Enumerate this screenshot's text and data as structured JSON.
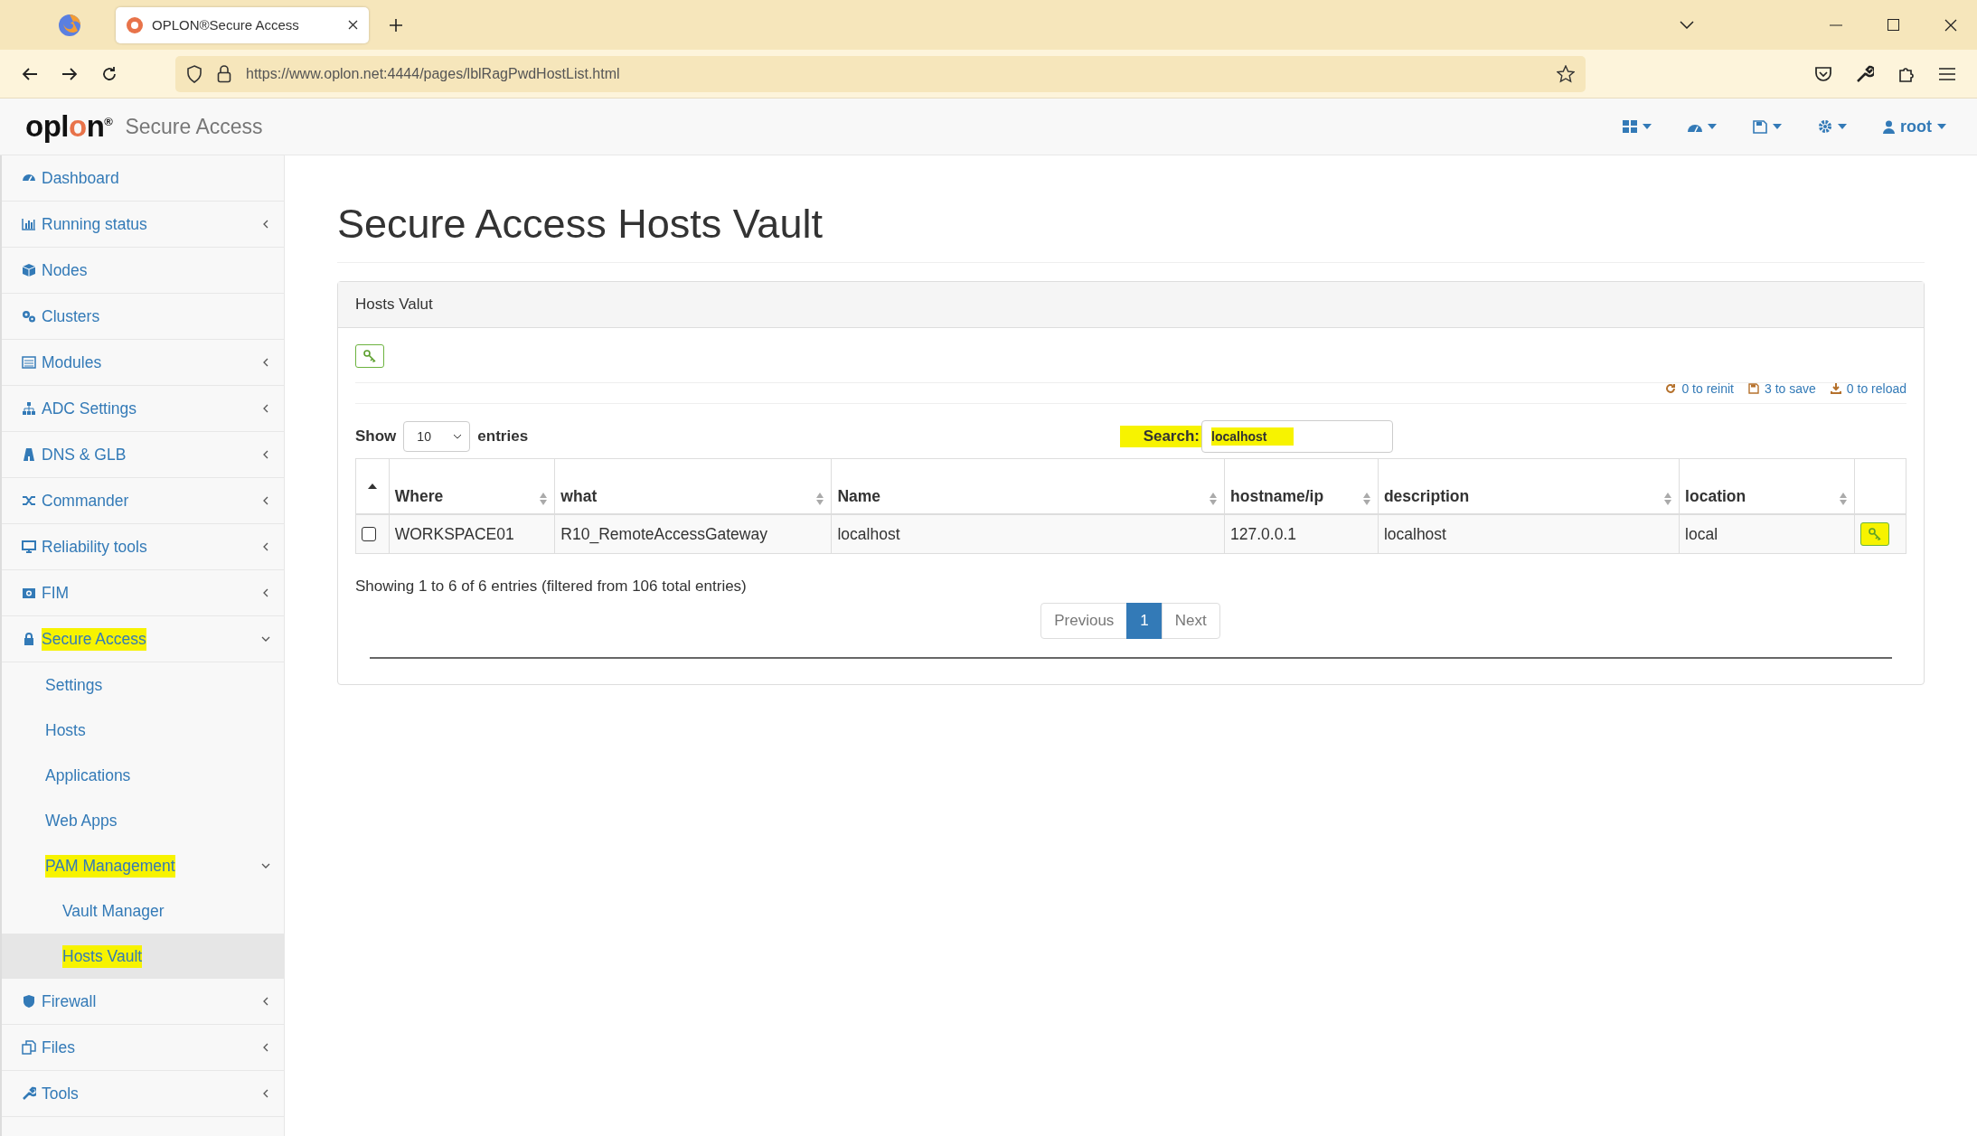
{
  "browser": {
    "tab_title": "OPLON®Secure Access",
    "url": "https://www.oplon.net:4444/pages/lblRagPwdHostList.html"
  },
  "header": {
    "logo": "oplon",
    "logo_mark": "®",
    "product": "Secure Access",
    "user": "root"
  },
  "sidebar": {
    "items": [
      {
        "label": "Dashboard",
        "has_children": false,
        "expanded": false,
        "selected": false,
        "highlighted": false
      },
      {
        "label": "Running status",
        "has_children": true,
        "expanded": false,
        "selected": false,
        "highlighted": false
      },
      {
        "label": "Nodes",
        "has_children": false,
        "expanded": false,
        "selected": false,
        "highlighted": false
      },
      {
        "label": "Clusters",
        "has_children": false,
        "expanded": false,
        "selected": false,
        "highlighted": false
      },
      {
        "label": "Modules",
        "has_children": true,
        "expanded": false,
        "selected": false,
        "highlighted": false
      },
      {
        "label": "ADC Settings",
        "has_children": true,
        "expanded": false,
        "selected": false,
        "highlighted": false
      },
      {
        "label": "DNS & GLB",
        "has_children": true,
        "expanded": false,
        "selected": false,
        "highlighted": false
      },
      {
        "label": "Commander",
        "has_children": true,
        "expanded": false,
        "selected": false,
        "highlighted": false
      },
      {
        "label": "Reliability tools",
        "has_children": true,
        "expanded": false,
        "selected": false,
        "highlighted": false
      },
      {
        "label": "FIM",
        "has_children": true,
        "expanded": false,
        "selected": false,
        "highlighted": false
      },
      {
        "label": "Secure Access",
        "has_children": true,
        "expanded": true,
        "selected": false,
        "highlighted": true,
        "children": [
          {
            "label": "Settings",
            "has_children": false,
            "expanded": false,
            "selected": false,
            "highlighted": false
          },
          {
            "label": "Hosts",
            "has_children": false,
            "expanded": false,
            "selected": false,
            "highlighted": false
          },
          {
            "label": "Applications",
            "has_children": false,
            "expanded": false,
            "selected": false,
            "highlighted": false
          },
          {
            "label": "Web Apps",
            "has_children": false,
            "expanded": false,
            "selected": false,
            "highlighted": false
          },
          {
            "label": "PAM Management",
            "has_children": true,
            "expanded": true,
            "selected": false,
            "highlighted": true,
            "children": [
              {
                "label": "Vault Manager",
                "has_children": false,
                "expanded": false,
                "selected": false,
                "highlighted": false
              },
              {
                "label": "Hosts Vault",
                "has_children": false,
                "expanded": false,
                "selected": true,
                "highlighted": true
              }
            ]
          }
        ]
      },
      {
        "label": "Firewall",
        "has_children": true,
        "expanded": false,
        "selected": false,
        "highlighted": false
      },
      {
        "label": "Files",
        "has_children": true,
        "expanded": false,
        "selected": false,
        "highlighted": false
      },
      {
        "label": "Tools",
        "has_children": true,
        "expanded": false,
        "selected": false,
        "highlighted": false
      }
    ]
  },
  "page_title": "Secure Access Hosts Vault",
  "panel": {
    "title": "Hosts Valut",
    "status_links": [
      "0 to reinit",
      "3 to save",
      "0 to reload"
    ],
    "length": {
      "label_before": "Show",
      "value": "10",
      "label_after": "entries"
    },
    "search": {
      "label": "Search:",
      "value": "localhost",
      "highlighted": true
    },
    "table": {
      "columns": [
        {
          "label": "Where",
          "sortable": true
        },
        {
          "label": "what",
          "sortable": true
        },
        {
          "label": "Name",
          "sortable": true
        },
        {
          "label": "hostname/ip",
          "sortable": true
        },
        {
          "label": "description",
          "sortable": true
        },
        {
          "label": "location",
          "sortable": true
        }
      ],
      "rows": [
        {
          "checked": false,
          "cells": [
            "WORKSPACE01",
            "R10_RemoteAccessGateway",
            "localhost",
            "127.0.0.1",
            "localhost",
            "local"
          ],
          "action_highlighted": true
        }
      ]
    },
    "info": "Showing 1 to 6 of 6 entries (filtered from 106 total entries)",
    "pagination": [
      {
        "label": "Previous",
        "selected": false
      },
      {
        "label": "1",
        "selected": true
      },
      {
        "label": "Next",
        "selected": false
      }
    ]
  }
}
